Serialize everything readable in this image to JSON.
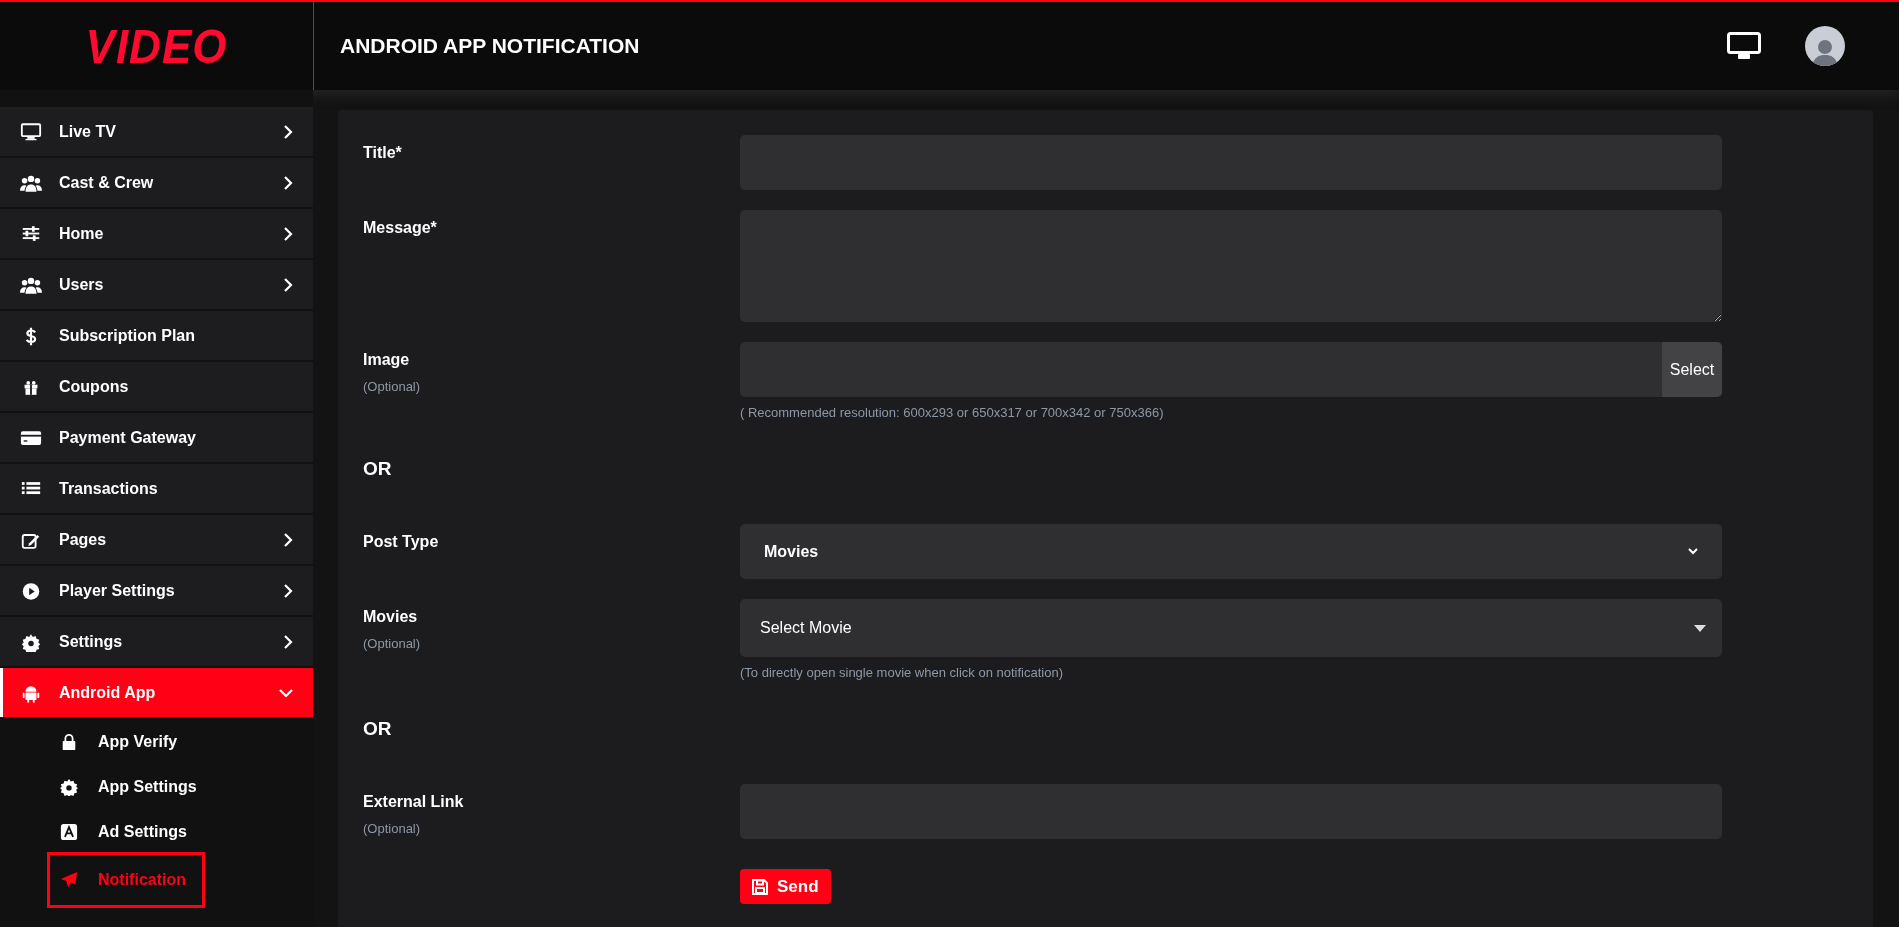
{
  "header": {
    "logo": "VIDEO",
    "title": "ANDROID APP NOTIFICATION"
  },
  "sidebar": {
    "items": [
      {
        "label": "Live TV",
        "has_submenu": true,
        "expanded": false,
        "selected": false
      },
      {
        "label": "Cast & Crew",
        "has_submenu": true,
        "expanded": false,
        "selected": false
      },
      {
        "label": "Home",
        "has_submenu": true,
        "expanded": false,
        "selected": false
      },
      {
        "label": "Users",
        "has_submenu": true,
        "expanded": false,
        "selected": false
      },
      {
        "label": "Subscription Plan",
        "selected": false
      },
      {
        "label": "Coupons",
        "selected": false
      },
      {
        "label": "Payment Gateway",
        "selected": false
      },
      {
        "label": "Transactions",
        "selected": false
      },
      {
        "label": "Pages",
        "has_submenu": true,
        "expanded": false,
        "selected": false
      },
      {
        "label": "Player Settings",
        "has_submenu": true,
        "expanded": false,
        "selected": false
      },
      {
        "label": "Settings",
        "has_submenu": true,
        "expanded": false,
        "selected": false
      },
      {
        "label": "Android App",
        "has_submenu": true,
        "expanded": true,
        "selected": true,
        "children": [
          {
            "label": "App Verify",
            "selected": false
          },
          {
            "label": "App Settings",
            "selected": false
          },
          {
            "label": "Ad Settings",
            "selected": false
          },
          {
            "label": "Notification",
            "selected": true
          }
        ]
      }
    ]
  },
  "form": {
    "rows": [
      {
        "kind": "input",
        "label": "Title*"
      },
      {
        "kind": "textarea",
        "label": "Message*"
      },
      {
        "kind": "file",
        "label": "Image",
        "note": "(Optional)",
        "button": "Select",
        "help": "( Recommended resolution: 600x293 or 650x317 or 700x342 or 750x366)"
      },
      {
        "kind": "or",
        "label": "OR"
      },
      {
        "kind": "select",
        "label": "Post Type",
        "value": "Movies"
      },
      {
        "kind": "dropdown",
        "label": "Movies",
        "note": "(Optional)",
        "value": "Select Movie",
        "help": "(To directly open single movie when click on notification)"
      },
      {
        "kind": "or",
        "label": "OR"
      },
      {
        "kind": "input",
        "label": "External Link",
        "note": "(Optional)"
      }
    ],
    "submit": "Send"
  }
}
